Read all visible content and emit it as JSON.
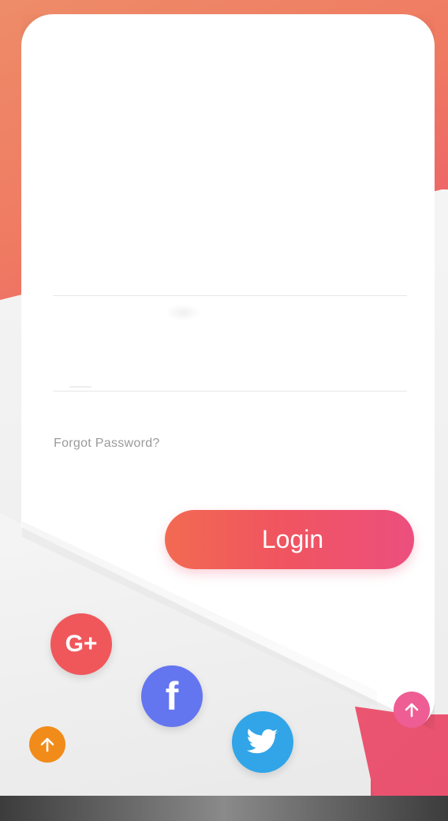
{
  "login_form": {
    "forgot_password_label": "Forgot Password?",
    "login_button_label": "Login"
  },
  "social": {
    "google_label": "G+",
    "facebook_label": "f"
  },
  "icons": {
    "google": "google-plus-icon",
    "facebook": "facebook-icon",
    "twitter": "twitter-bird-icon",
    "arrow_up_left": "arrow-up-icon",
    "arrow_up_right": "arrow-up-icon"
  },
  "colors": {
    "accent_gradient_start": "#f26a52",
    "accent_gradient_end": "#ec4f7e",
    "google": "#f0575b",
    "facebook": "#6475f0",
    "twitter": "#31a5e8",
    "orange_button": "#f18b19",
    "pink_button": "#ee5d93"
  }
}
